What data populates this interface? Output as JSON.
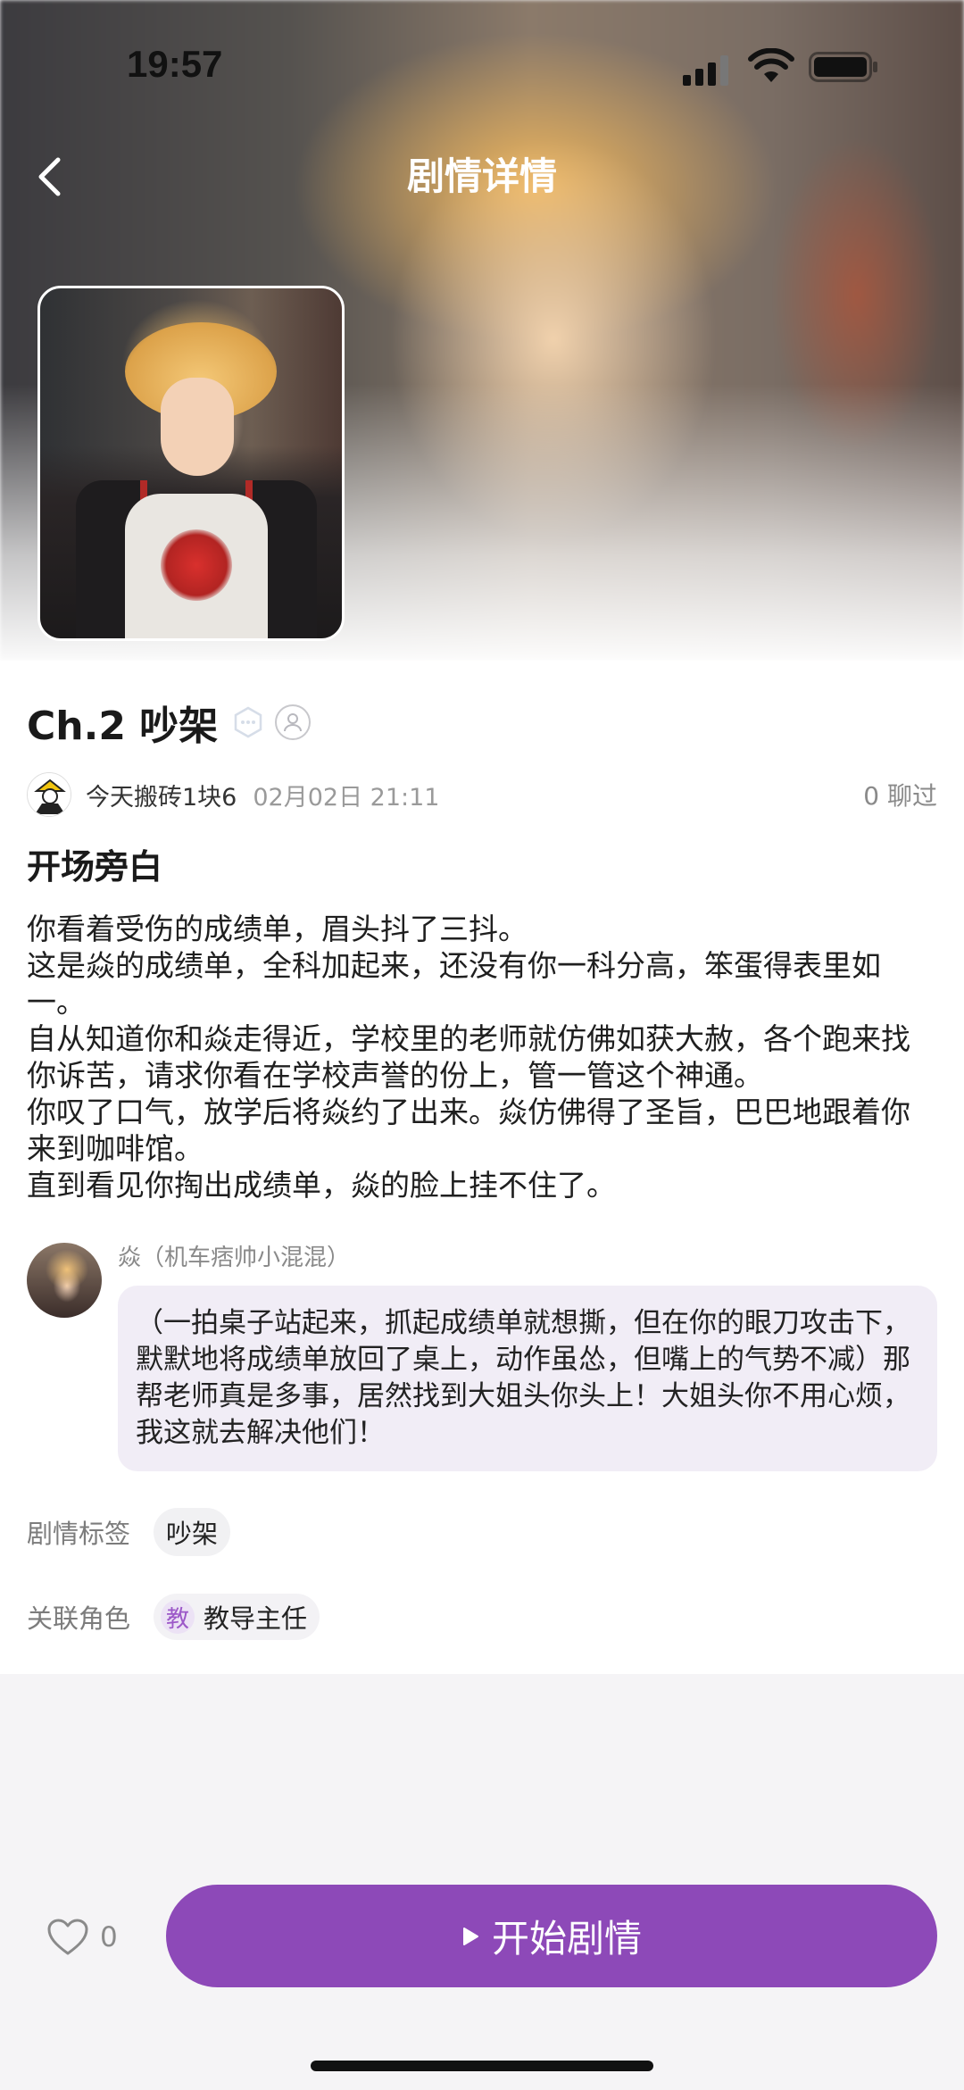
{
  "status_bar": {
    "time": "19:57"
  },
  "nav": {
    "title": "剧情详情"
  },
  "story": {
    "chapter_title": "Ch.2 吵架",
    "author": "今天搬砖1块6",
    "date": "02月02日 21:11",
    "chat_count": "0 聊过"
  },
  "narration": {
    "title": "开场旁白",
    "lines": [
      "你看着受伤的成绩单，眉头抖了三抖。",
      "这是焱的成绩单，全科加起来，还没有你一科分高，笨蛋得表里如一。",
      "自从知道你和焱走得近，学校里的老师就仿佛如获大赦，各个跑来找你诉苦，请求你看在学校声誉的份上，管一管这个神通。",
      "你叹了口气，放学后将焱约了出来。焱仿佛得了圣旨，巴巴地跟着你来到咖啡馆。",
      "直到看见你掏出成绩单，焱的脸上挂不住了。"
    ]
  },
  "dialog": {
    "speaker": "焱（机车痞帅小混混）",
    "text": "（一拍桌子站起来，抓起成绩单就想撕，但在你的眼刀攻击下，默默地将成绩单放回了桌上，动作虽怂，但嘴上的气势不减）那帮老师真是多事，居然找到大姐头你头上！大姐头你不用心烦，我这就去解决他们！"
  },
  "tags": {
    "label": "剧情标签",
    "items": [
      "吵架"
    ]
  },
  "roles": {
    "label": "关联角色",
    "items": [
      {
        "icon_char": "教",
        "name": "教导主任"
      }
    ]
  },
  "bottom": {
    "like_count": "0",
    "start_label": "开始剧情"
  },
  "colors": {
    "accent": "#8d49b8",
    "bubble": "#f1edf6"
  },
  "icons": {
    "back": "chevron-left-icon",
    "like": "heart-icon",
    "play": "play-icon"
  }
}
